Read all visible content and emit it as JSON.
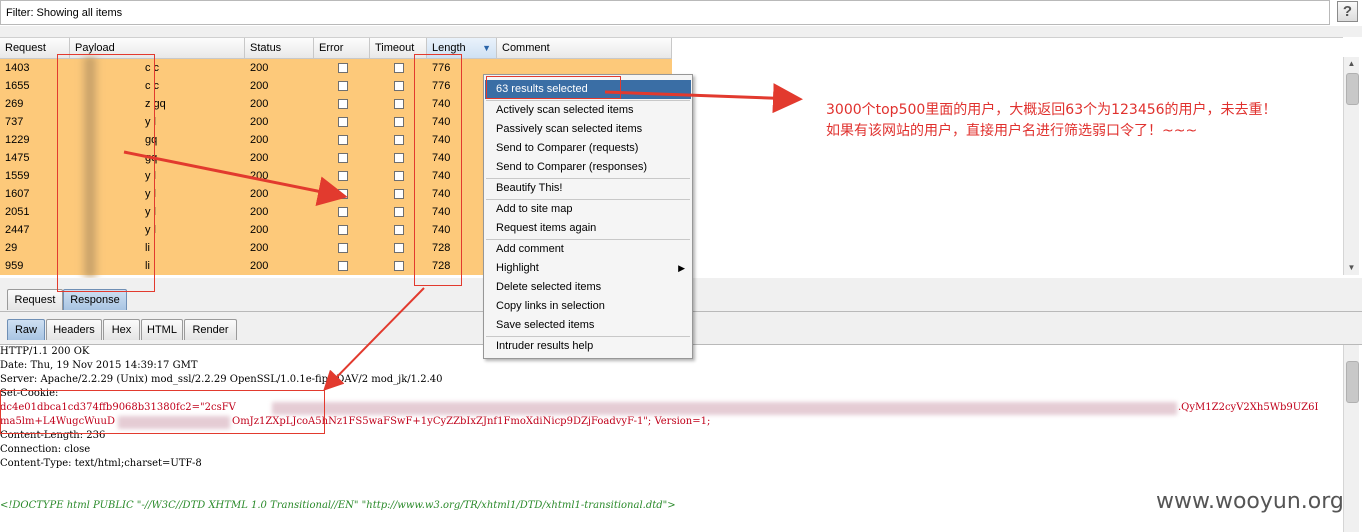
{
  "filter": {
    "text": "Filter:  Showing all items",
    "help": "?"
  },
  "table": {
    "columns": [
      "Request",
      "Payload",
      "Status",
      "Error",
      "Timeout",
      "Length",
      "Comment"
    ],
    "rows": [
      {
        "request": "1403",
        "payload": "c   c",
        "status": "200",
        "length": "776"
      },
      {
        "request": "1655",
        "payload": "c   c",
        "status": "200",
        "length": "776"
      },
      {
        "request": "269",
        "payload": "z   gq",
        "status": "200",
        "length": "740"
      },
      {
        "request": "737",
        "payload": "y   l",
        "status": "200",
        "length": "740"
      },
      {
        "request": "1229",
        "payload": "    gq",
        "status": "200",
        "length": "740"
      },
      {
        "request": "1475",
        "payload": "    gq",
        "status": "200",
        "length": "740"
      },
      {
        "request": "1559",
        "payload": "y   l",
        "status": "200",
        "length": "740"
      },
      {
        "request": "1607",
        "payload": "y   l",
        "status": "200",
        "length": "740"
      },
      {
        "request": "2051",
        "payload": "y   l",
        "status": "200",
        "length": "740"
      },
      {
        "request": "2447",
        "payload": "y   l",
        "status": "200",
        "length": "740"
      },
      {
        "request": "29",
        "payload": "li",
        "status": "200",
        "length": "728"
      },
      {
        "request": "959",
        "payload": "li",
        "status": "200",
        "length": "728"
      }
    ]
  },
  "tabs_top": [
    "Request",
    "Response"
  ],
  "tabs_view": [
    "Raw",
    "Headers",
    "Hex",
    "HTML",
    "Render"
  ],
  "response": [
    "HTTP/1.1 200 OK",
    "Date: Thu, 19 Nov 2015 14:39:17 GMT",
    "Server: Apache/2.2.29 (Unix) mod_ssl/2.2.29 OpenSSL/1.0.1e-fips DAV/2 mod_jk/1.2.40",
    "Set-Cookie:",
    "dc4e01dbca1cd374ffb9068b31380fc2=\"2csFV",
    ".QyM1Z2cyV2Xh5Wb9UZ6I",
    "ma5lm+L4WugcWuuD",
    "OmJz1ZXpLJcoA5hNz1FS5waFSwF+1yCyZZbIxZJnf1FmoXdiNicp9DZjFoadvyF-1\"; Version=1;",
    "Content-Length: 236",
    "Connection: close",
    "Content-Type: text/html;charset=UTF-8",
    "<!DOCTYPE html PUBLIC \"-//W3C//DTD XHTML 1.0 Transitional//EN\" \"http://www.w3.org/TR/xhtml1/DTD/xhtml1-transitional.dtd\">"
  ],
  "menu": {
    "header": "63 results selected",
    "groups": [
      [
        "Actively scan selected items",
        "Passively scan selected items",
        "Send to Comparer (requests)",
        "Send to Comparer (responses)"
      ],
      [
        "Beautify This!"
      ],
      [
        "Add to site map",
        "Request items again"
      ],
      [
        "Add comment",
        "Highlight",
        "Delete selected items",
        "Copy links in selection",
        "Save selected items"
      ],
      [
        "Intruder results help"
      ]
    ]
  },
  "annotation": {
    "line1": "3000个top500里面的用户，大概返回63个为123456的用户，未去重！",
    "line2": "如果有该网站的用户，直接用户名进行筛选弱口令了！~~~"
  },
  "watermark": "www.wooyun.org",
  "colors": {
    "row_highlight": "#fdc97a",
    "menu_header": "#3a6ea5",
    "annotation": "#e0312e"
  }
}
